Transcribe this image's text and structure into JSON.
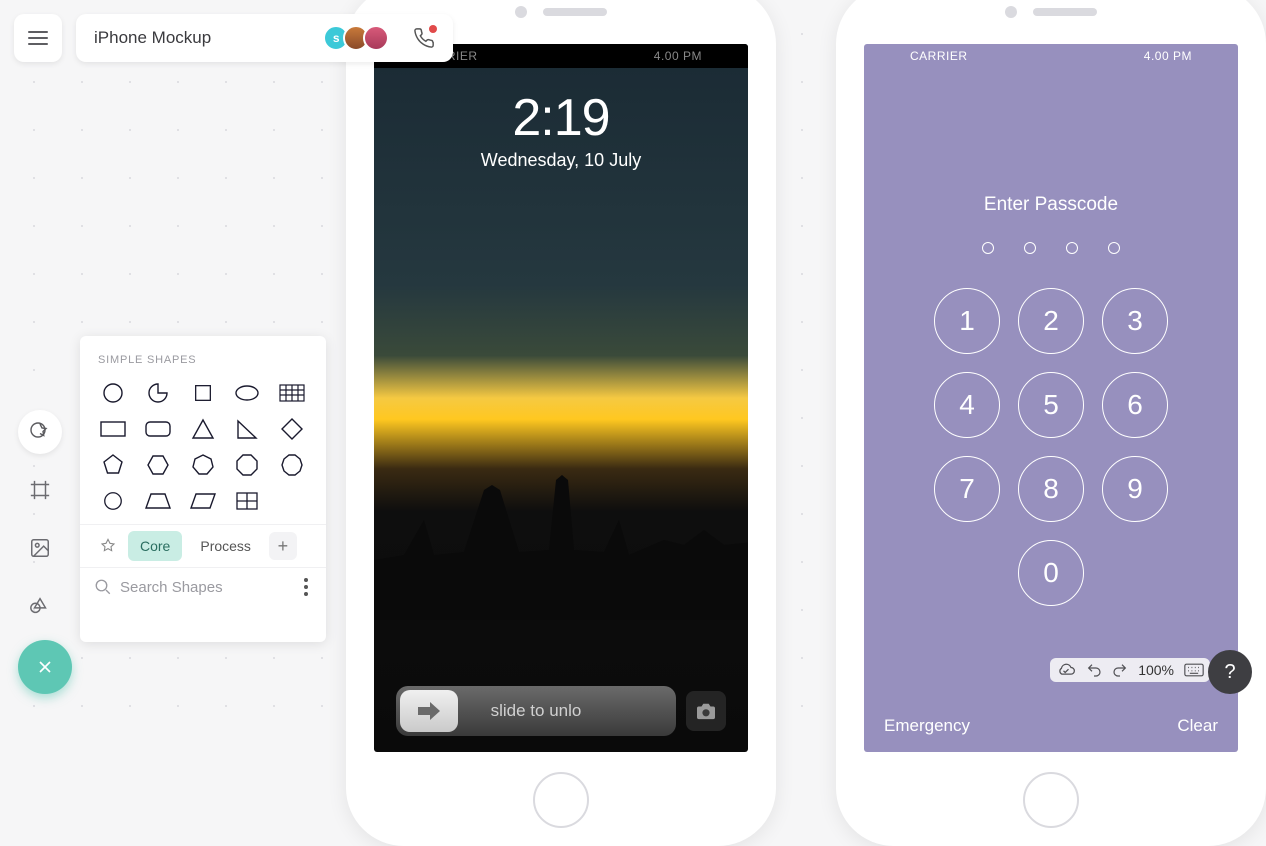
{
  "doc_title": "iPhone Mockup",
  "avatars": {
    "initial": "s"
  },
  "shapes": {
    "header": "SIMPLE SHAPES",
    "tabs": {
      "core": "Core",
      "process": "Process"
    },
    "search_placeholder": "Search Shapes"
  },
  "phone_left": {
    "carrier": "CARRIER",
    "time_bar": "4.00 PM",
    "lock_time": "2:19",
    "lock_date": "Wednesday, 10 July",
    "slide_text": "slide to unlo"
  },
  "phone_right": {
    "carrier": "CARRIER",
    "time_bar": "4.00 PM",
    "enter": "Enter Passcode",
    "keys": [
      "1",
      "2",
      "3",
      "4",
      "5",
      "6",
      "7",
      "8",
      "9",
      "0"
    ],
    "emergency": "Emergency",
    "clear": "Clear"
  },
  "toolbar": {
    "zoom": "100%",
    "help": "?"
  }
}
